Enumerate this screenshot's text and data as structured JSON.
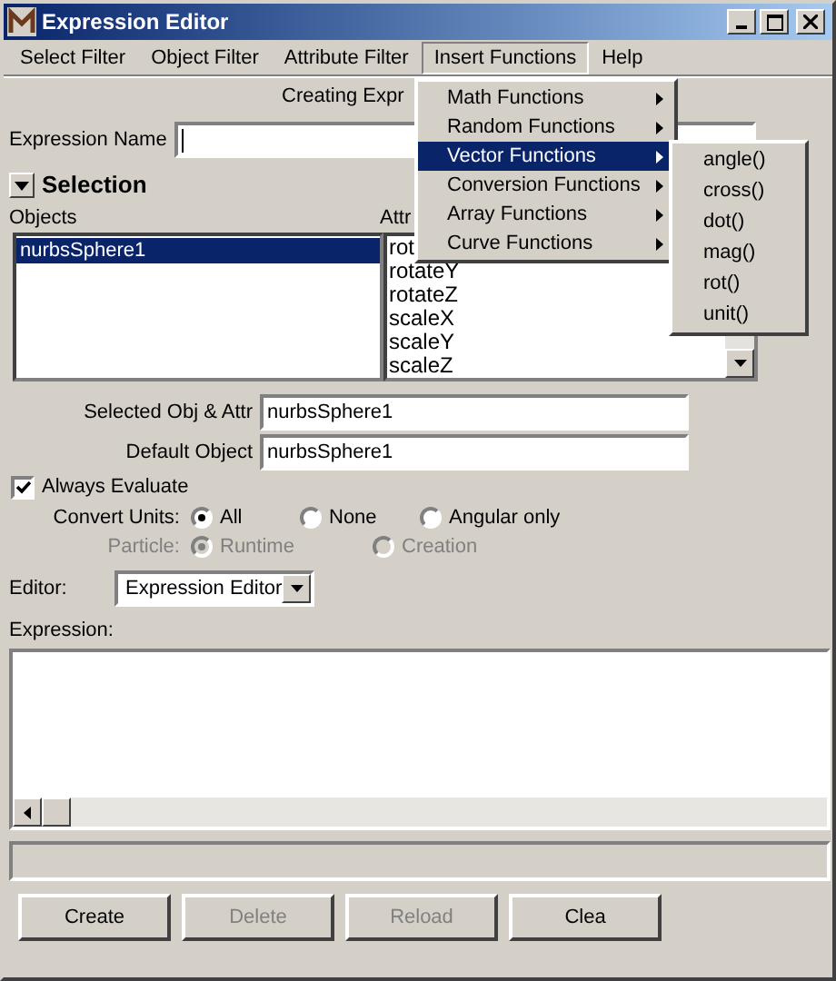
{
  "window": {
    "title": "Expression Editor"
  },
  "menu_bar": [
    {
      "label": "Select Filter",
      "selected": false
    },
    {
      "label": "Object Filter",
      "selected": false
    },
    {
      "label": "Attribute Filter",
      "selected": false
    },
    {
      "label": "Insert Functions",
      "selected": true
    },
    {
      "label": "Help",
      "selected": false
    }
  ],
  "dropdown": [
    {
      "label": "Math Functions",
      "selected": false
    },
    {
      "label": "Random Functions",
      "selected": false
    },
    {
      "label": "Vector Functions",
      "selected": true
    },
    {
      "label": "Conversion Functions",
      "selected": false
    },
    {
      "label": "Array Functions",
      "selected": false
    },
    {
      "label": "Curve Functions",
      "selected": false
    }
  ],
  "submenu": [
    "angle()",
    "cross()",
    "dot()",
    "mag()",
    "rot()",
    "unit()"
  ],
  "header": "Creating Expr",
  "expression_name": {
    "label": "Expression Name"
  },
  "selection": {
    "title": "Selection",
    "expanded": true,
    "objects_label": "Objects",
    "attributes_label": "Attr",
    "objects": [
      {
        "label": "nurbsSphere1",
        "selected": true
      }
    ],
    "attributes": [
      "rot",
      "rotateY",
      "rotateZ",
      "scaleX",
      "scaleY",
      "scaleZ"
    ]
  },
  "selected_obj_attr": {
    "label": "Selected Obj & Attr",
    "value": "nurbsSphere1"
  },
  "default_object": {
    "label": "Default Object",
    "value": "nurbsSphere1"
  },
  "always_evaluate": {
    "label": "Always Evaluate",
    "checked": true
  },
  "convert_units": {
    "label": "Convert Units:",
    "disabled": false,
    "options": [
      {
        "label": "All",
        "selected": true
      },
      {
        "label": "None",
        "selected": false
      },
      {
        "label": "Angular only",
        "selected": false
      }
    ]
  },
  "particle": {
    "label": "Particle:",
    "disabled": true,
    "options": [
      {
        "label": "Runtime",
        "selected": true
      },
      {
        "label": "Creation",
        "selected": false
      }
    ]
  },
  "editor": {
    "label": "Editor:",
    "value": "Expression Editor"
  },
  "expression": {
    "label": "Expression:"
  },
  "buttons": [
    {
      "label": "Create",
      "disabled": false
    },
    {
      "label": "Delete",
      "disabled": true
    },
    {
      "label": "Reload",
      "disabled": true
    },
    {
      "label": "Clea",
      "disabled": false
    }
  ]
}
